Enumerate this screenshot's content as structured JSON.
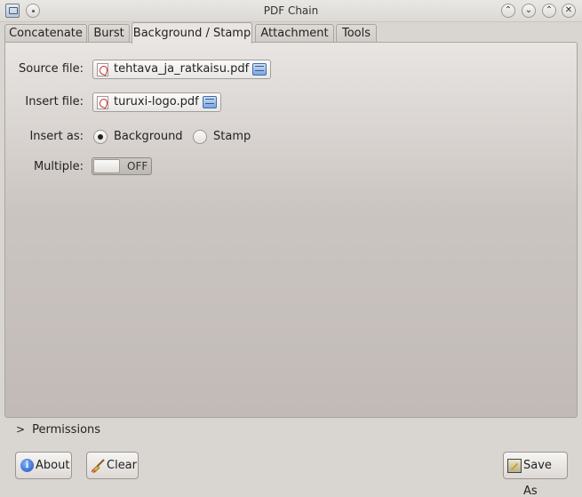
{
  "window": {
    "title": "PDF Chain",
    "buttons": {
      "shade": "⌃",
      "minimize": "⌄",
      "maximize": "⌃",
      "close": "✕"
    }
  },
  "tabs": [
    {
      "label": "Concatenate"
    },
    {
      "label": "Burst"
    },
    {
      "label": "Background / Stamp"
    },
    {
      "label": "Attachment"
    },
    {
      "label": "Tools"
    }
  ],
  "form": {
    "source_label": "Source file:",
    "source_value": "tehtava_ja_ratkaisu.pdf",
    "insert_label": "Insert file:",
    "insert_value": "turuxi-logo.pdf",
    "insert_as_label": "Insert as:",
    "options": [
      {
        "label": "Background",
        "checked": true
      },
      {
        "label": "Stamp",
        "checked": false
      }
    ],
    "multiple_label": "Multiple:",
    "multiple_state": "OFF"
  },
  "permissions": {
    "label": "Permissions",
    "chevron": ">"
  },
  "buttons": {
    "about": "About",
    "clear": "Clear",
    "save_as": "Save As"
  },
  "icons": {
    "app": "pdf-chain-app-icon",
    "pdf": "pdf-file-icon",
    "folder": "open-folder-icon",
    "info": "info-icon",
    "broom": "broom-icon",
    "save": "save-as-icon"
  }
}
